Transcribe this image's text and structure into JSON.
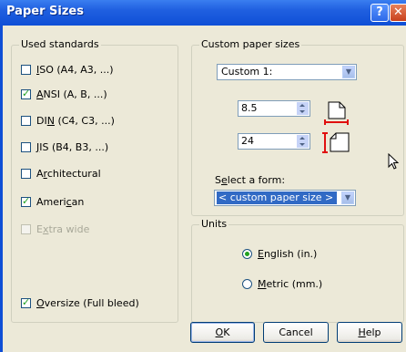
{
  "window": {
    "title": "Paper Sizes",
    "help_glyph": "?",
    "close_glyph": "✕"
  },
  "used_standards": {
    "title": "Used standards",
    "items": [
      {
        "pre": "",
        "key": "I",
        "post": "SO (A4, A3, ...)",
        "checked": false,
        "enabled": true
      },
      {
        "pre": "",
        "key": "A",
        "post": "NSI (A, B, ...)",
        "checked": true,
        "enabled": true
      },
      {
        "pre": "DI",
        "key": "N",
        "post": " (C4, C3, ...)",
        "checked": false,
        "enabled": true
      },
      {
        "pre": "",
        "key": "J",
        "post": "IS (B4, B3, ...)",
        "checked": false,
        "enabled": true
      },
      {
        "pre": "A",
        "key": "r",
        "post": "chitectural",
        "checked": false,
        "enabled": true
      },
      {
        "pre": "Ameri",
        "key": "c",
        "post": "an",
        "checked": true,
        "enabled": true
      },
      {
        "pre": "E",
        "key": "x",
        "post": "tra wide",
        "checked": false,
        "enabled": false
      }
    ],
    "oversize": {
      "pre": "",
      "key": "O",
      "post": "versize (Full bleed)",
      "checked": true
    }
  },
  "custom_paper": {
    "title": "Custom paper sizes",
    "dropdown_value": "Custom 1:",
    "width_value": "8.5",
    "height_value": "24",
    "form_label_pre": "S",
    "form_label_key": "e",
    "form_label_post": "lect a form:",
    "form_value": "< custom paper size >"
  },
  "units": {
    "title": "Units",
    "english": {
      "pre": "",
      "key": "E",
      "post": "nglish (in.)",
      "checked": true
    },
    "metric": {
      "pre": "",
      "key": "M",
      "post": "etric (mm.)",
      "checked": false
    }
  },
  "buttons": {
    "ok": {
      "pre": "",
      "key": "O",
      "post": "K"
    },
    "cancel": "Cancel",
    "help": {
      "pre": "",
      "key": "H",
      "post": "elp"
    }
  },
  "colors": {
    "title_bar": "#0f4fd6",
    "dialog_bg": "#ece9d8",
    "selection": "#316ac5",
    "dimension_marker": "#e01010"
  },
  "icons": [
    "paper-width-icon",
    "paper-height-icon",
    "mouse-pointer-icon"
  ]
}
